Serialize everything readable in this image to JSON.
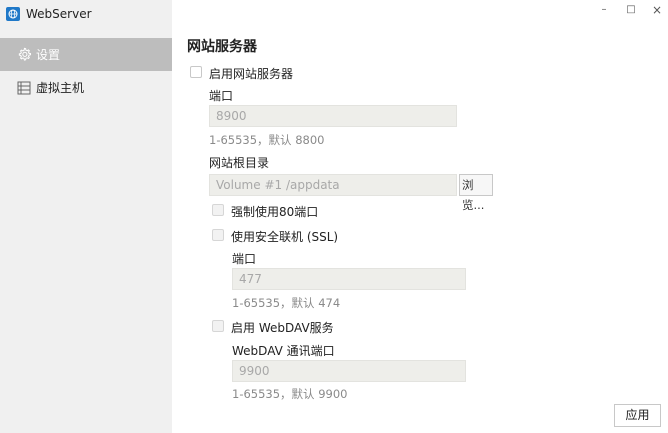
{
  "window": {
    "title": "WebServer",
    "controls": {
      "minimize": "–",
      "maximize": "□",
      "close": "×"
    }
  },
  "sidebar": {
    "items": [
      {
        "label": "设置",
        "icon": "gear-icon",
        "active": true
      },
      {
        "label": "虚拟主机",
        "icon": "server-icon",
        "active": false
      }
    ]
  },
  "main": {
    "title": "网站服务器",
    "enable_label": "启用网站服务器",
    "port_label": "端口",
    "port_value": "8900",
    "port_hint": "1-65535，默认 8800",
    "root_label": "网站根目录",
    "root_placeholder": "Volume #1 /appdata",
    "browse_label": "浏览...",
    "force80_label": "强制使用80端口",
    "ssl_label": "使用安全联机 (SSL)",
    "ssl_port_label": "端口",
    "ssl_port_value": "477",
    "ssl_port_hint": "1-65535，默认 474",
    "webdav_label": "启用 WebDAV服务",
    "webdav_port_label": "WebDAV 通讯端口",
    "webdav_port_value": "9900",
    "webdav_port_hint": "1-65535，默认 9900",
    "apply_label": "应用"
  },
  "colors": {
    "sidebar_bg": "#f0f0f0",
    "sidebar_active": "#bdbdbd",
    "app_icon": "#1f78c8",
    "field_bg": "#eeeeea"
  }
}
